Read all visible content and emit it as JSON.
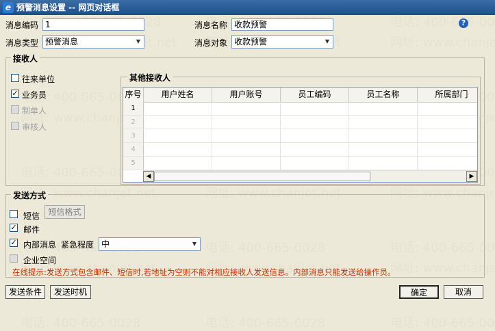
{
  "window": {
    "title": "预警消息设置 -- 网页对话框"
  },
  "watermark": {
    "phone": "电话: 400-665-0028",
    "site": "网址: www.chanjet.net"
  },
  "form": {
    "code_label": "消息编码",
    "code_value": "1",
    "name_label": "消息名称",
    "name_value": "收款预警",
    "type_label": "消息类型",
    "type_value": "预警消息",
    "object_label": "消息对象",
    "object_value": "收款预警"
  },
  "receivers": {
    "title": "接收人",
    "options": [
      {
        "label": "往来单位",
        "checked": false,
        "disabled": false
      },
      {
        "label": "业务员",
        "checked": true,
        "disabled": false
      },
      {
        "label": "制单人",
        "checked": false,
        "disabled": true
      },
      {
        "label": "审核人",
        "checked": false,
        "disabled": true
      }
    ],
    "other_title": "其他接收人",
    "columns": [
      "序号",
      "用户姓名",
      "用户账号",
      "员工编码",
      "员工名称",
      "所属部门"
    ],
    "row_numbers": [
      "1",
      "2",
      "3",
      "4",
      "5"
    ]
  },
  "send": {
    "title": "发送方式",
    "sms_label": "短信",
    "sms_checked": false,
    "sms_format_button": "短信格式",
    "mail_label": "邮件",
    "mail_checked": true,
    "internal_label": "内部消息",
    "internal_checked": true,
    "urgency_label": "紧急程度",
    "urgency_value": "中",
    "enterprise_label": "企业空间",
    "enterprise_checked": false,
    "hint": "在线提示:发送方式包含邮件、短信时,若地址为空则不能对相应接收人发送信息。内部消息只能发送给操作员。"
  },
  "footer": {
    "send_condition": "发送条件",
    "send_timing": "发送时机",
    "ok": "确定",
    "cancel": "取消"
  }
}
